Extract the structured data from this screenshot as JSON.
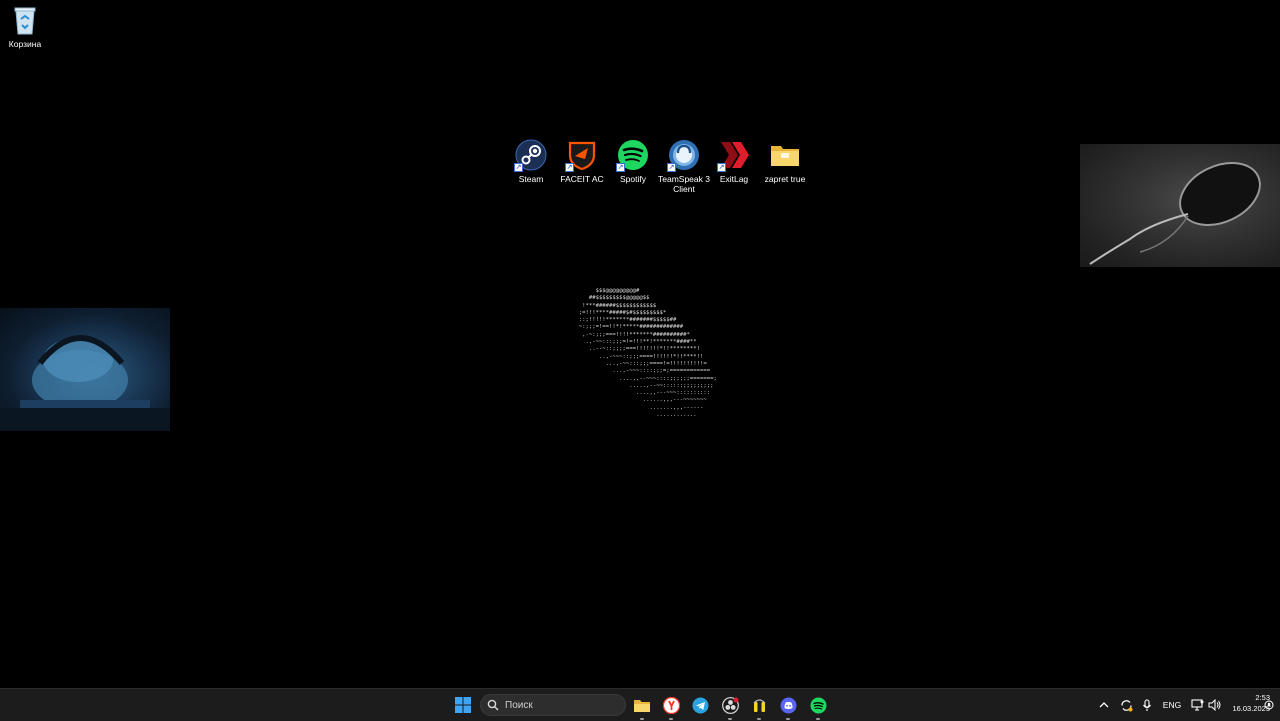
{
  "desktop": {
    "recycle_bin_label": "Корзина",
    "icons": [
      {
        "label": "Steam",
        "icon": "steam-icon"
      },
      {
        "label": "FACEIT AC",
        "icon": "faceit-icon"
      },
      {
        "label": "Spotify",
        "icon": "spotify-icon"
      },
      {
        "label": "TeamSpeak 3 Client",
        "icon": "teamspeak-icon"
      },
      {
        "label": "ExitLag",
        "icon": "exitlag-icon"
      },
      {
        "label": "zapret true",
        "icon": "folder-icon"
      }
    ]
  },
  "ascii_art": [
    "       $$$@@@@@@@@@#",
    "     ##$$$$$$$$$@@@@@$$",
    "   !***######$$$$$$$$$$$$",
    "  ;=!!!****#####$#$$$$$$$$$*",
    "  ::;!!!!!*******#######$$$$$##",
    "  ~:;;;=!==!!*!*****#############",
    "   ,-~:;;;===!!!!*******##########*",
    "    .,-~~:::;;;=!=!!!**!*******####**",
    "     ..--~::;;;;===!!!!!!!*!!********!",
    "        ..,-~~~::;;;====!!!!!!*!!****!!",
    "          ...,-~~:::;;;====!=!!!!!!!!!!=",
    "            ...,-~~~::::;;;=;============",
    "              ....,,--~~~::::;;;;;;=======;",
    "                 .....,--~~::::::;;;;;;;;;",
    "                   ....,,---~~~::::::::::",
    "                     ......,,,---~~~~~~~",
    "                       .......,,,------",
    "                         ............"
  ],
  "taskbar": {
    "search_placeholder": "Поиск",
    "pinned": [
      "start-icon",
      "folder-icon",
      "yandex-browser-icon",
      "telegram-icon",
      "obs-icon",
      "kakaotalk-icon",
      "discord-icon",
      "spotify-icon"
    ],
    "language": "ENG",
    "time": "2:53",
    "date": "16.03.2025"
  },
  "colors": {
    "desktop_bg": "#000000",
    "taskbar_bg": "#1c1c1c",
    "spotify": "#1ed760",
    "faceit": "#ff5500",
    "exitlag": "#c0121e",
    "steam": "#1b2838",
    "folder": "#f7c948"
  }
}
